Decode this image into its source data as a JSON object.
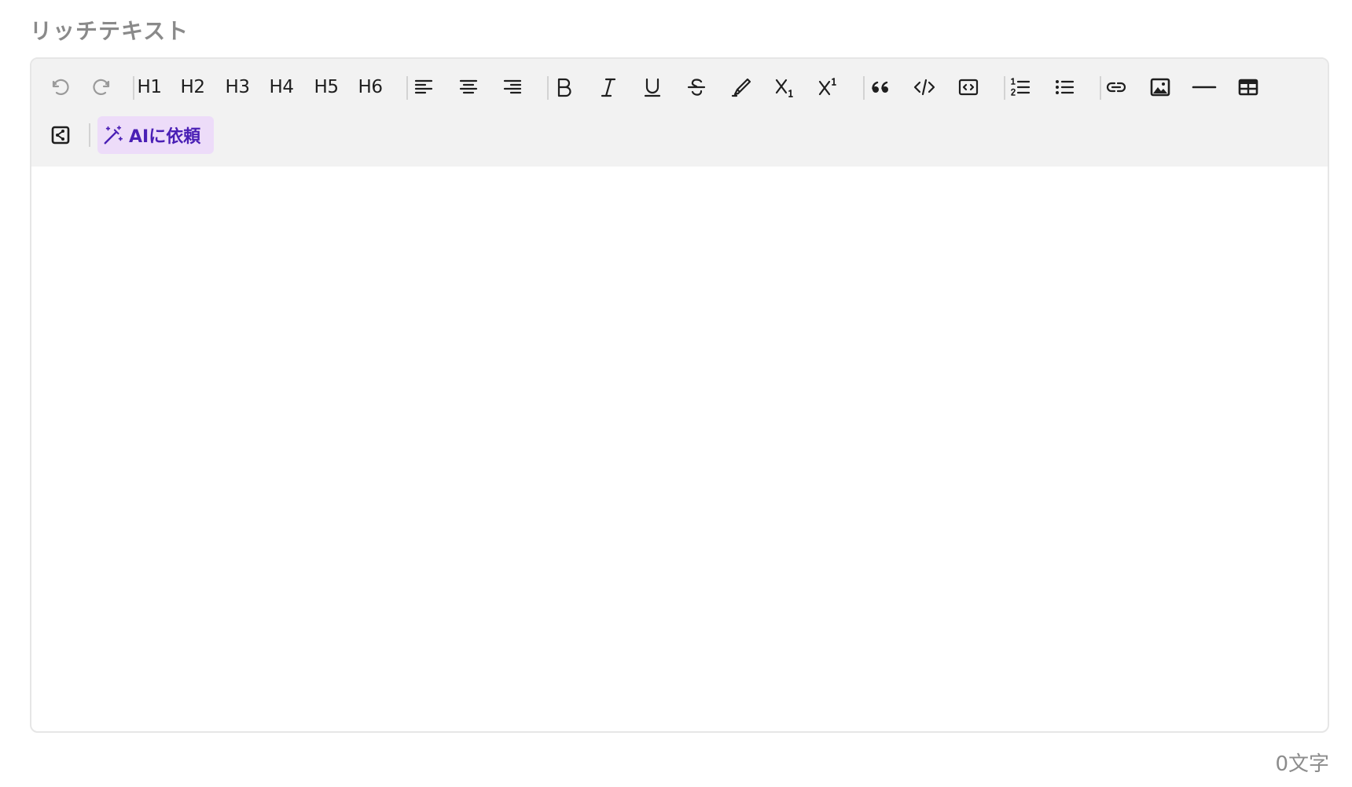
{
  "field": {
    "label": "リッチテキスト"
  },
  "toolbar": {
    "headings": {
      "h1": "H1",
      "h2": "H2",
      "h3": "H3",
      "h4": "H4",
      "h5": "H5",
      "h6": "H6"
    },
    "icons": {
      "undo": "undo-icon",
      "redo": "redo-icon",
      "align_left": "align-left-icon",
      "align_center": "align-center-icon",
      "align_right": "align-right-icon",
      "bold": "bold-icon",
      "italic": "italic-icon",
      "underline": "underline-icon",
      "strikethrough": "strikethrough-icon",
      "highlight": "highlighter-icon",
      "subscript": "subscript-icon",
      "superscript": "superscript-icon",
      "blockquote": "quote-icon",
      "code": "code-icon",
      "code_block": "code-block-icon",
      "ordered_list": "ordered-list-icon",
      "bullet_list": "bullet-list-icon",
      "link": "link-icon",
      "image": "image-icon",
      "horizontal_rule": "horizontal-rule-icon",
      "table": "table-icon",
      "embed": "embed-icon",
      "ai_magic": "magic-wand-icon"
    },
    "ai_button_label": "AIに依頼"
  },
  "editor": {
    "content": ""
  },
  "footer": {
    "char_count": "0文字"
  },
  "colors": {
    "toolbar_bg": "#f2f2f2",
    "ai_button_bg": "#eddcf9",
    "ai_button_text": "#4a1fb5",
    "label_text": "#8a8a8a",
    "border": "#e6e6e6"
  }
}
